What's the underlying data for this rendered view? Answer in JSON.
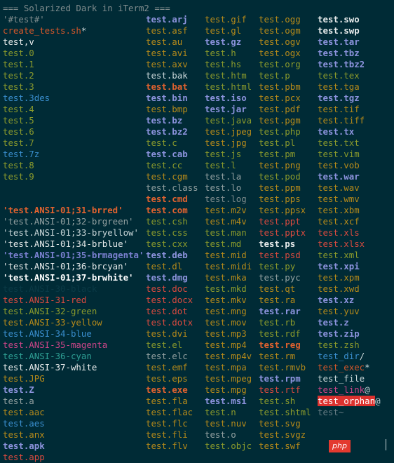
{
  "colors": {
    "background": "#002b36",
    "base0": "#839496",
    "base1": "#93a1a1",
    "base2": "#eee8d5",
    "base3": "#fdf6e3",
    "base02": "#073642",
    "yellow": "#b58900",
    "orange": "#cb4b16",
    "red": "#dc322f",
    "magenta": "#d33682",
    "violet": "#6c71c4",
    "blue": "#268bd2",
    "cyan": "#2aa198",
    "green": "#859900"
  },
  "columns": [
    [
      {
        "text": "=== Solarized Dark in iTerm2 ===",
        "color": "#7f8c8d"
      },
      {
        "text": "'#test#'",
        "color": "#7f8c8d"
      },
      {
        "text": "create_tests.sh",
        "color": "#d4572a",
        "suffix": "*",
        "suffix_color": "#c8d6d8"
      },
      {
        "text": "test,v",
        "color": "#e9ecec"
      },
      {
        "text": "test.0",
        "color": "#8a9a2c"
      },
      {
        "text": "test.1",
        "color": "#8a9a2c"
      },
      {
        "text": "test.2",
        "color": "#8a9a2c"
      },
      {
        "text": "test.3",
        "color": "#8a9a2c"
      },
      {
        "text": "test.3des",
        "color": "#3a8fcf"
      },
      {
        "text": "test.4",
        "color": "#8a9a2c"
      },
      {
        "text": "test.5",
        "color": "#8a9a2c"
      },
      {
        "text": "test.6",
        "color": "#8a9a2c"
      },
      {
        "text": "test.7",
        "color": "#8a9a2c"
      },
      {
        "text": "test.7z",
        "color": "#3a8fcf"
      },
      {
        "text": "test.8",
        "color": "#8a9a2c"
      },
      {
        "text": "test.9",
        "color": "#8a9a2c"
      },
      {
        "text": "",
        "color": "#839496"
      },
      {
        "text": "",
        "color": "#839496"
      },
      {
        "text": "'test.ANSI-01;31-brred'",
        "color": "#e0622f",
        "bold": true
      },
      {
        "text": "'test.ANSI-01;32-brgreen'",
        "color": "#93a1a1"
      },
      {
        "text": "'test.ANSI-01;33-bryellow'",
        "color": "#c8d6d8"
      },
      {
        "text": "'test.ANSI-01;34-brblue'",
        "color": "#e6eaea"
      },
      {
        "text": "'test.ANSI-01;35-brmagenta'",
        "color": "#7a80d0",
        "bold": true
      },
      {
        "text": "'test.ANSI-01;36-brcyan'",
        "color": "#e6eaea"
      },
      {
        "text": "'test.ANSI-01;37-brwhite'",
        "color": "#ffffff",
        "bold": true
      },
      {
        "text": "test.ANSI-30-black",
        "color": "#0a3a46"
      },
      {
        "text": "test.ANSI-31-red",
        "color": "#d94a3f"
      },
      {
        "text": "test.ANSI-32-green",
        "color": "#8a9a2c"
      },
      {
        "text": "test.ANSI-33-yellow",
        "color": "#b58a1a"
      },
      {
        "text": "test.ANSI-34-blue",
        "color": "#3a8fcf"
      },
      {
        "text": "test.ANSI-35-magenta",
        "color": "#cc4588"
      },
      {
        "text": "test.ANSI-36-cyan",
        "color": "#2e9f94"
      },
      {
        "text": "test.ANSI-37-white",
        "color": "#e9ecec"
      },
      {
        "text": "test.JPG",
        "color": "#b58a1a"
      },
      {
        "text": "test.Z",
        "color": "#8c93dd",
        "bold": true
      },
      {
        "text": "test.a",
        "color": "#93a1a1"
      },
      {
        "text": "test.aac",
        "color": "#b58a1a"
      },
      {
        "text": "test.aes",
        "color": "#3a8fcf"
      },
      {
        "text": "test.anx",
        "color": "#b58a1a"
      },
      {
        "text": "test.apk",
        "color": "#8c93dd",
        "bold": true
      },
      {
        "text": "test.app",
        "color": "#d94a3f"
      }
    ],
    [
      {
        "text": "",
        "color": "#839496"
      },
      {
        "text": "test.arj",
        "color": "#8c93dd",
        "bold": true
      },
      {
        "text": "test.asf",
        "color": "#b58a1a"
      },
      {
        "text": "test.au",
        "color": "#b58a1a"
      },
      {
        "text": "test.avi",
        "color": "#b58a1a"
      },
      {
        "text": "test.axv",
        "color": "#b58a1a"
      },
      {
        "text": "test.bak",
        "color": "#c8d6d8"
      },
      {
        "text": "test.bat",
        "color": "#e0622f",
        "bold": true
      },
      {
        "text": "test.bin",
        "color": "#8c93dd",
        "bold": true
      },
      {
        "text": "test.bmp",
        "color": "#b58a1a"
      },
      {
        "text": "test.bz",
        "color": "#8c93dd",
        "bold": true
      },
      {
        "text": "test.bz2",
        "color": "#8c93dd",
        "bold": true
      },
      {
        "text": "test.c",
        "color": "#8a9a2c"
      },
      {
        "text": "test.cab",
        "color": "#8c93dd",
        "bold": true
      },
      {
        "text": "test.cc",
        "color": "#8a9a2c"
      },
      {
        "text": "test.cgm",
        "color": "#b58a1a"
      },
      {
        "text": "test.class",
        "color": "#93a1a1"
      },
      {
        "text": "test.cmd",
        "color": "#e0622f",
        "bold": true
      },
      {
        "text": "test.com",
        "color": "#e0622f",
        "bold": true
      },
      {
        "text": "test.csh",
        "color": "#8a9a2c"
      },
      {
        "text": "test.css",
        "color": "#8a9a2c"
      },
      {
        "text": "test.cxx",
        "color": "#8a9a2c"
      },
      {
        "text": "test.deb",
        "color": "#8c93dd",
        "bold": true
      },
      {
        "text": "test.dl",
        "color": "#b58a1a"
      },
      {
        "text": "test.dmg",
        "color": "#8c93dd",
        "bold": true
      },
      {
        "text": "test.doc",
        "color": "#d94a3f"
      },
      {
        "text": "test.docx",
        "color": "#d94a3f"
      },
      {
        "text": "test.dot",
        "color": "#d94a3f"
      },
      {
        "text": "test.dotx",
        "color": "#d94a3f"
      },
      {
        "text": "test.dvi",
        "color": "#b58a1a"
      },
      {
        "text": "test.el",
        "color": "#8a9a2c"
      },
      {
        "text": "test.elc",
        "color": "#93a1a1"
      },
      {
        "text": "test.emf",
        "color": "#b58a1a"
      },
      {
        "text": "test.eps",
        "color": "#b58a1a"
      },
      {
        "text": "test.exe",
        "color": "#e0622f",
        "bold": true
      },
      {
        "text": "test.fla",
        "color": "#b58a1a"
      },
      {
        "text": "test.flac",
        "color": "#b58a1a"
      },
      {
        "text": "test.flc",
        "color": "#b58a1a"
      },
      {
        "text": "test.fli",
        "color": "#b58a1a"
      },
      {
        "text": "test.flv",
        "color": "#b58a1a"
      }
    ],
    [
      {
        "text": "",
        "color": "#839496"
      },
      {
        "text": "test.gif",
        "color": "#b58a1a"
      },
      {
        "text": "test.gl",
        "color": "#b58a1a"
      },
      {
        "text": "test.gz",
        "color": "#8c93dd",
        "bold": true
      },
      {
        "text": "test.h",
        "color": "#8a9a2c"
      },
      {
        "text": "test.hs",
        "color": "#8a9a2c"
      },
      {
        "text": "test.htm",
        "color": "#8a9a2c"
      },
      {
        "text": "test.html",
        "color": "#8a9a2c"
      },
      {
        "text": "test.iso",
        "color": "#8c93dd",
        "bold": true
      },
      {
        "text": "test.jar",
        "color": "#8c93dd",
        "bold": true
      },
      {
        "text": "test.java",
        "color": "#8a9a2c"
      },
      {
        "text": "test.jpeg",
        "color": "#b58a1a"
      },
      {
        "text": "test.jpg",
        "color": "#b58a1a"
      },
      {
        "text": "test.js",
        "color": "#8a9a2c"
      },
      {
        "text": "test.l",
        "color": "#8a9a2c"
      },
      {
        "text": "test.la",
        "color": "#93a1a1"
      },
      {
        "text": "test.lo",
        "color": "#93a1a1"
      },
      {
        "text": "test.log",
        "color": "#7f8c8d"
      },
      {
        "text": "test.m2v",
        "color": "#b58a1a"
      },
      {
        "text": "test.m4v",
        "color": "#b58a1a"
      },
      {
        "text": "test.man",
        "color": "#8a9a2c"
      },
      {
        "text": "test.md",
        "color": "#8a9a2c"
      },
      {
        "text": "test.mid",
        "color": "#b58a1a"
      },
      {
        "text": "test.midi",
        "color": "#b58a1a"
      },
      {
        "text": "test.mka",
        "color": "#b58a1a"
      },
      {
        "text": "test.mkd",
        "color": "#8a9a2c"
      },
      {
        "text": "test.mkv",
        "color": "#b58a1a"
      },
      {
        "text": "test.mng",
        "color": "#b58a1a"
      },
      {
        "text": "test.mov",
        "color": "#b58a1a"
      },
      {
        "text": "test.mp3",
        "color": "#b58a1a"
      },
      {
        "text": "test.mp4",
        "color": "#b58a1a"
      },
      {
        "text": "test.mp4v",
        "color": "#b58a1a"
      },
      {
        "text": "test.mpa",
        "color": "#b58a1a"
      },
      {
        "text": "test.mpeg",
        "color": "#b58a1a"
      },
      {
        "text": "test.mpg",
        "color": "#b58a1a"
      },
      {
        "text": "test.msi",
        "color": "#8c93dd",
        "bold": true
      },
      {
        "text": "test.n",
        "color": "#8a9a2c"
      },
      {
        "text": "test.nuv",
        "color": "#b58a1a"
      },
      {
        "text": "test.o",
        "color": "#93a1a1"
      },
      {
        "text": "test.objc",
        "color": "#8a9a2c"
      }
    ],
    [
      {
        "text": "",
        "color": "#839496"
      },
      {
        "text": "test.ogg",
        "color": "#b58a1a"
      },
      {
        "text": "test.ogm",
        "color": "#b58a1a"
      },
      {
        "text": "test.ogv",
        "color": "#b58a1a"
      },
      {
        "text": "test.ogx",
        "color": "#b58a1a"
      },
      {
        "text": "test.org",
        "color": "#8a9a2c"
      },
      {
        "text": "test.p",
        "color": "#8a9a2c"
      },
      {
        "text": "test.pbm",
        "color": "#b58a1a"
      },
      {
        "text": "test.pcx",
        "color": "#b58a1a"
      },
      {
        "text": "test.pdf",
        "color": "#b58a1a"
      },
      {
        "text": "test.pgm",
        "color": "#b58a1a"
      },
      {
        "text": "test.php",
        "color": "#8a9a2c"
      },
      {
        "text": "test.pl",
        "color": "#8a9a2c"
      },
      {
        "text": "test.pm",
        "color": "#8a9a2c"
      },
      {
        "text": "test.png",
        "color": "#b58a1a"
      },
      {
        "text": "test.pod",
        "color": "#8a9a2c"
      },
      {
        "text": "test.ppm",
        "color": "#b58a1a"
      },
      {
        "text": "test.pps",
        "color": "#b58a1a"
      },
      {
        "text": "test.ppsx",
        "color": "#b58a1a"
      },
      {
        "text": "test.ppt",
        "color": "#d94a3f"
      },
      {
        "text": "test.pptx",
        "color": "#d94a3f"
      },
      {
        "text": "test.ps",
        "color": "#e6eaea",
        "bold": true
      },
      {
        "text": "test.psd",
        "color": "#d94a3f"
      },
      {
        "text": "test.py",
        "color": "#8a9a2c"
      },
      {
        "text": "test.pyc",
        "color": "#93a1a1"
      },
      {
        "text": "test.qt",
        "color": "#b58a1a"
      },
      {
        "text": "test.ra",
        "color": "#b58a1a"
      },
      {
        "text": "test.rar",
        "color": "#8c93dd",
        "bold": true
      },
      {
        "text": "test.rb",
        "color": "#8a9a2c"
      },
      {
        "text": "test.rdf",
        "color": "#8a9a2c"
      },
      {
        "text": "test.reg",
        "color": "#e0622f",
        "bold": true
      },
      {
        "text": "test.rm",
        "color": "#b58a1a"
      },
      {
        "text": "test.rmvb",
        "color": "#b58a1a"
      },
      {
        "text": "test.rpm",
        "color": "#8c93dd",
        "bold": true
      },
      {
        "text": "test.rtf",
        "color": "#d94a3f"
      },
      {
        "text": "test.sh",
        "color": "#8a9a2c"
      },
      {
        "text": "test.shtml",
        "color": "#8a9a2c"
      },
      {
        "text": "test.svg",
        "color": "#b58a1a"
      },
      {
        "text": "test.svgz",
        "color": "#b58a1a"
      },
      {
        "text": "test.swf",
        "color": "#b58a1a"
      }
    ],
    [
      {
        "text": "",
        "color": "#839496"
      },
      {
        "text": "test.swo",
        "color": "#e6eaea",
        "bold": true
      },
      {
        "text": "test.swp",
        "color": "#e6eaea",
        "bold": true
      },
      {
        "text": "test.tar",
        "color": "#8c93dd",
        "bold": true
      },
      {
        "text": "test.tbz",
        "color": "#8c93dd",
        "bold": true
      },
      {
        "text": "test.tbz2",
        "color": "#8c93dd",
        "bold": true
      },
      {
        "text": "test.tex",
        "color": "#8a9a2c"
      },
      {
        "text": "test.tga",
        "color": "#b58a1a"
      },
      {
        "text": "test.tgz",
        "color": "#8c93dd",
        "bold": true
      },
      {
        "text": "test.tif",
        "color": "#b58a1a"
      },
      {
        "text": "test.tiff",
        "color": "#b58a1a"
      },
      {
        "text": "test.tx",
        "color": "#8c93dd",
        "bold": true
      },
      {
        "text": "test.txt",
        "color": "#8a9a2c"
      },
      {
        "text": "test.vim",
        "color": "#8a9a2c"
      },
      {
        "text": "test.vob",
        "color": "#b58a1a"
      },
      {
        "text": "test.war",
        "color": "#8c93dd",
        "bold": true
      },
      {
        "text": "test.wav",
        "color": "#b58a1a"
      },
      {
        "text": "test.wmv",
        "color": "#b58a1a"
      },
      {
        "text": "test.xbm",
        "color": "#b58a1a"
      },
      {
        "text": "test.xcf",
        "color": "#b58a1a"
      },
      {
        "text": "test.xls",
        "color": "#d94a3f"
      },
      {
        "text": "test.xlsx",
        "color": "#d94a3f"
      },
      {
        "text": "test.xml",
        "color": "#8a9a2c"
      },
      {
        "text": "test.xpi",
        "color": "#8c93dd",
        "bold": true
      },
      {
        "text": "test.xpm",
        "color": "#b58a1a"
      },
      {
        "text": "test.xwd",
        "color": "#b58a1a"
      },
      {
        "text": "test.xz",
        "color": "#8c93dd",
        "bold": true
      },
      {
        "text": "test.yuv",
        "color": "#b58a1a"
      },
      {
        "text": "test.z",
        "color": "#8c93dd",
        "bold": true
      },
      {
        "text": "test.zip",
        "color": "#8c93dd",
        "bold": true
      },
      {
        "text": "test.zsh",
        "color": "#8a9a2c"
      },
      {
        "text": "test_dir",
        "color": "#3a8fcf",
        "suffix": "/",
        "suffix_color": "#c8d6d8"
      },
      {
        "text": "test_exec",
        "color": "#d4572a",
        "suffix": "*",
        "suffix_color": "#c8d6d8"
      },
      {
        "text": "test_file",
        "color": "#c8d6d8"
      },
      {
        "text": "test_link",
        "color": "#cc4588",
        "suffix": "@",
        "suffix_color": "#c8d6d8"
      },
      {
        "text": "test_orphan",
        "color": "#ffffff",
        "bg": "#dc322f",
        "suffix": "@",
        "suffix_color": "#c8d6d8"
      },
      {
        "text": "test~",
        "color": "#657b83"
      }
    ]
  ]
}
